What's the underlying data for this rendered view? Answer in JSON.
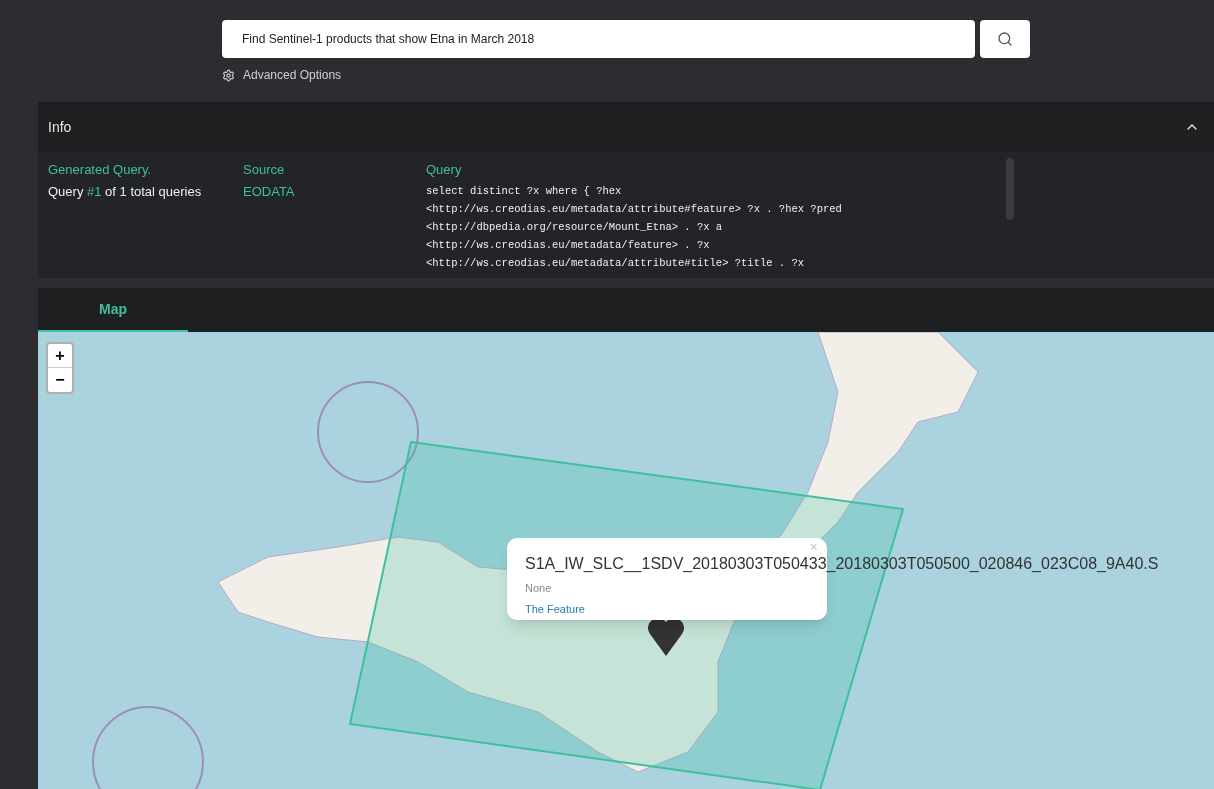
{
  "search": {
    "value": "Find Sentinel-1 products that show Etna in March 2018"
  },
  "advanced_options": {
    "label": "Advanced Options"
  },
  "info": {
    "title": "Info",
    "expanded": true,
    "generated_query": {
      "label": "Generated Query.",
      "prefix": "Query ",
      "number": "#1",
      "suffix": " of 1 total queries"
    },
    "source": {
      "label": "Source",
      "value": "EODATA"
    },
    "query": {
      "label": "Query",
      "lines": [
        "select distinct ?x where { ?hex",
        "<http://ws.creodias.eu/metadata/attribute#feature> ?x . ?hex ?pred",
        "<http://dbpedia.org/resource/Mount_Etna> . ?x a",
        "<http://ws.creodias.eu/metadata/feature> . ?x",
        "<http://ws.creodias.eu/metadata/attribute#title> ?title . ?x"
      ]
    }
  },
  "tabs": [
    {
      "label": "Map",
      "selected": true
    }
  ],
  "map": {
    "zoom_in": "+",
    "zoom_out": "−",
    "popup": {
      "title": "S1A_IW_SLC__1SDV_20180303T050433_20180303T050500_020846_023C08_9A40.S",
      "subtitle": "None",
      "link": "The Feature",
      "close": "×"
    }
  }
}
